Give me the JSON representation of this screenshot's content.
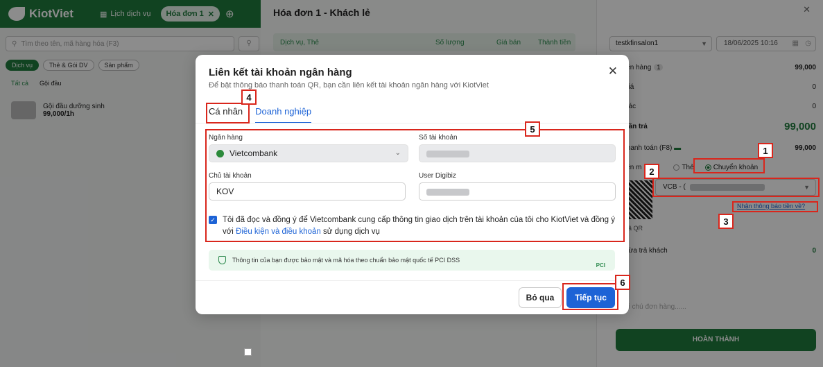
{
  "app": {
    "logo_text": "KiotViet",
    "nav_services": "Lịch dịch vụ",
    "nav_invoice": "Hóa đơn 1",
    "search_placeholder": "Tìm theo tên, mã hàng hóa (F3)"
  },
  "left": {
    "chips": [
      "Dịch vụ",
      "Thẻ & Gói DV",
      "Sản phẩm"
    ],
    "subfilters": [
      "Tất cả",
      "Gội đầu"
    ],
    "product_name": "Gội đầu dưỡng sinh",
    "product_price": "99,000/1h"
  },
  "middle": {
    "title": "Hóa đơn 1 - Khách lẻ",
    "headers": [
      "Dịch vụ, Thẻ",
      "Số lượng",
      "Giá bán",
      "Thành tiền"
    ]
  },
  "right": {
    "staff": "testkfinsalon1",
    "datetime": "18/06/2025 10:16",
    "rows": [
      {
        "label": "iền hàng",
        "badge": "1",
        "value": "99,000"
      },
      {
        "label": "giá",
        "value": "0"
      },
      {
        "label": "hác",
        "value": "0"
      },
      {
        "label": "cần trả",
        "value": "99,000"
      },
      {
        "label": "thanh toán (F8)",
        "value": "99,000"
      }
    ],
    "method_prefix": "iền m",
    "method_card": "Thẻ",
    "method_transfer": "Chuyển khoản",
    "account_prefix": "VCB - (",
    "notify_link": "Nhận thông báo tiền về?",
    "qr_caption": "hã QR",
    "return_label": "hừa trả khách",
    "return_value": "0",
    "note_placeholder": "hi chú đơn hàng......",
    "finish": "HOÀN THÀNH"
  },
  "modal": {
    "title": "Liên kết tài khoản ngân hàng",
    "subtitle": "Để bật thông báo thanh toán QR, bạn cần liên kết tài khoản ngân hàng với KiotViet",
    "tab_personal": "Cá nhân",
    "tab_business": "Doanh nghiệp",
    "bank_label": "Ngân hàng",
    "bank_value": "Vietcombank",
    "account_number_label": "Số tài khoản",
    "holder_label": "Chủ tài khoản",
    "holder_value": "KOV",
    "digibiz_label": "User Digibiz",
    "consent_text": "Tôi đã đọc và đồng ý để Vietcombank cung cấp thông tin giao dịch trên tài khoản của tôi cho KiotViet và đồng ý với",
    "consent_link": "Điều kiện và điều khoản",
    "consent_tail": "sử dụng dịch vụ",
    "security_note": "Thông tin của bạn được bảo mật và mã hóa theo chuẩn bảo mật quốc tế PCI DSS",
    "pci_badge": "PCI",
    "skip": "Bỏ qua",
    "next": "Tiếp tục"
  },
  "annotations": [
    "1",
    "2",
    "3",
    "4",
    "5",
    "6"
  ]
}
